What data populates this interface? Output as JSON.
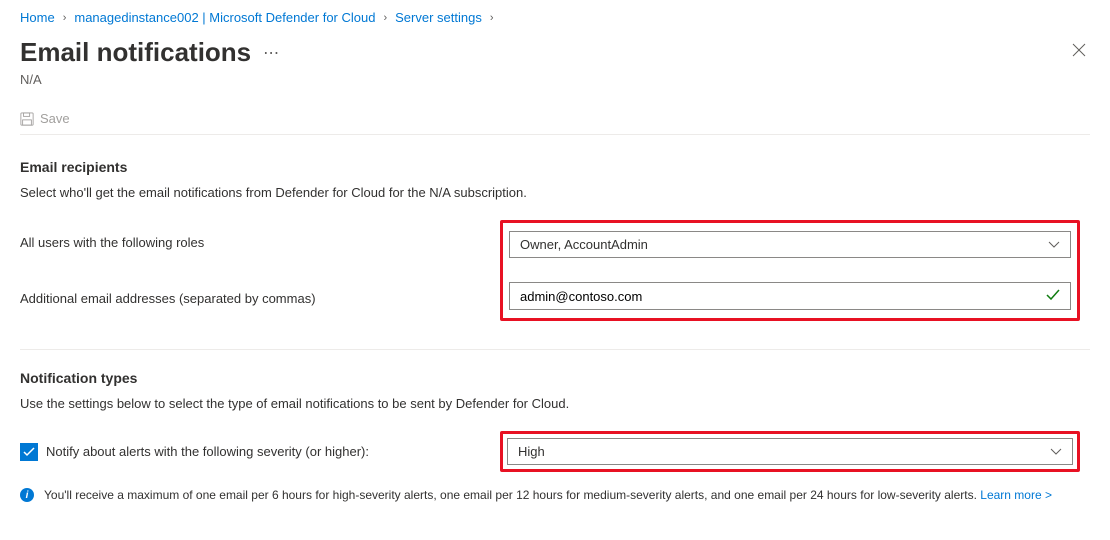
{
  "breadcrumb": {
    "home": "Home",
    "instance": "managedinstance002 | Microsoft Defender for Cloud",
    "server_settings": "Server settings"
  },
  "header": {
    "title": "Email notifications",
    "subtitle": "N/A"
  },
  "toolbar": {
    "save_label": "Save"
  },
  "section_recipients": {
    "title": "Email recipients",
    "description": "Select who'll get the email notifications from Defender for Cloud for the N/A subscription.",
    "roles_label": "All users with the following roles",
    "roles_value": "Owner, AccountAdmin",
    "emails_label": "Additional email addresses (separated by commas)",
    "emails_value": "admin@contoso.com"
  },
  "section_types": {
    "title": "Notification types",
    "description": "Use the settings below to select the type of email notifications to be sent by Defender for Cloud.",
    "severity_label": "Notify about alerts with the following severity (or higher):",
    "severity_value": "High"
  },
  "info": {
    "text": "You'll receive a maximum of one email per 6 hours for high-severity alerts, one email per 12 hours for medium-severity alerts, and one email per 24 hours for low-severity alerts.",
    "link_label": "Learn more >"
  }
}
